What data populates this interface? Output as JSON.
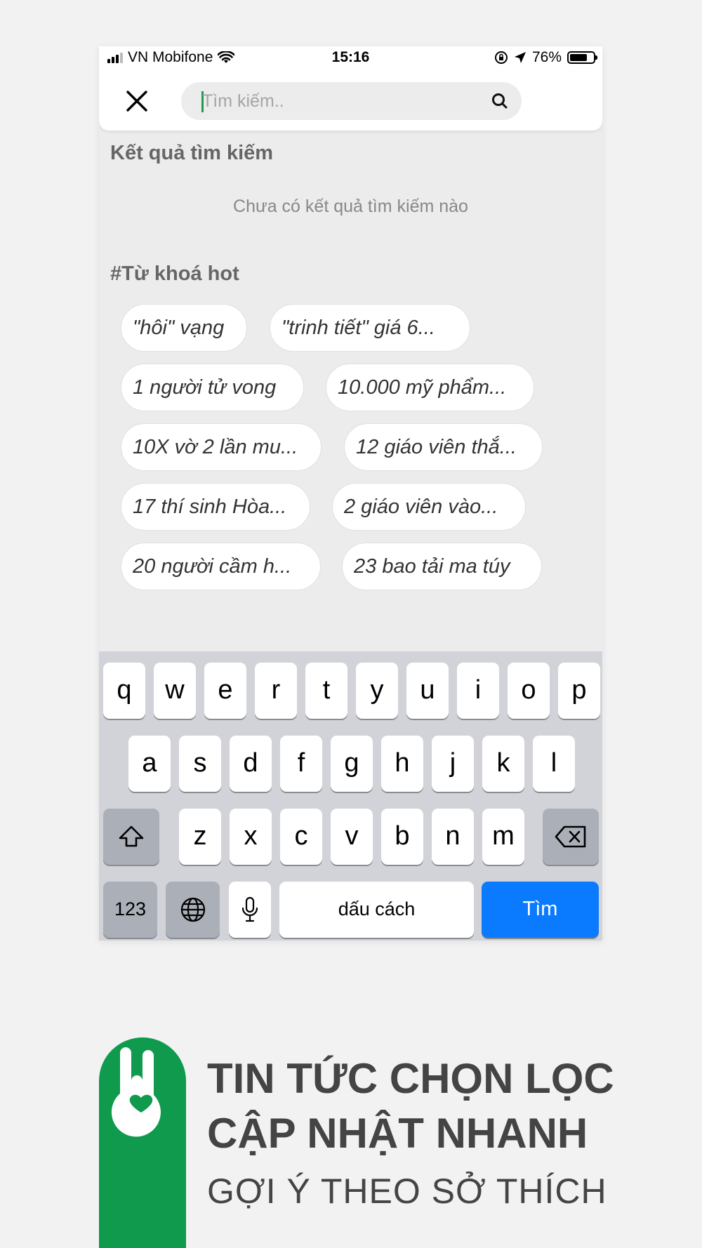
{
  "status_bar": {
    "carrier": "VN Mobifone",
    "time": "15:16",
    "battery": "76%",
    "battery_level": 0.76,
    "icons": [
      "signal-bars-icon",
      "wifi-icon",
      "rotation-lock-icon",
      "location-arrow-icon",
      "battery-icon"
    ]
  },
  "header": {
    "close_icon": "close-icon",
    "search_placeholder": "Tìm kiếm..",
    "search_value": "",
    "search_icon": "search-icon"
  },
  "results": {
    "title": "Kết quả tìm kiếm",
    "empty_text": "Chưa có kết quả tìm kiếm nào"
  },
  "hot_keywords": {
    "title": "#Từ khoá hot",
    "chips": [
      "\"hôi\" vạng",
      "\"trinh tiết\" giá 6...",
      "1 người tử vong",
      "10.000 mỹ phẩm...",
      "10X vờ 2 lần mu...",
      "12 giáo viên thắ...",
      "17 thí sinh Hòa...",
      "2 giáo viên vào...",
      "20 người cầm h...",
      "23 bao tải ma túy"
    ]
  },
  "keyboard": {
    "row1": [
      "q",
      "w",
      "e",
      "r",
      "t",
      "y",
      "u",
      "i",
      "o",
      "p"
    ],
    "row2": [
      "a",
      "s",
      "d",
      "f",
      "g",
      "h",
      "j",
      "k",
      "l"
    ],
    "row3": [
      "z",
      "x",
      "c",
      "v",
      "b",
      "n",
      "m"
    ],
    "numbers_key": "123",
    "space_key": "dấu cách",
    "go_key": "Tìm",
    "go_key_color": "#0a7aff"
  },
  "branding": {
    "line1": "TIN TỨC CHỌN LỌC",
    "line2": "CẬP NHẬT NHANH",
    "line3": "GỢI Ý THEO SỞ THÍCH",
    "brand_color": "#0f9a4d"
  }
}
